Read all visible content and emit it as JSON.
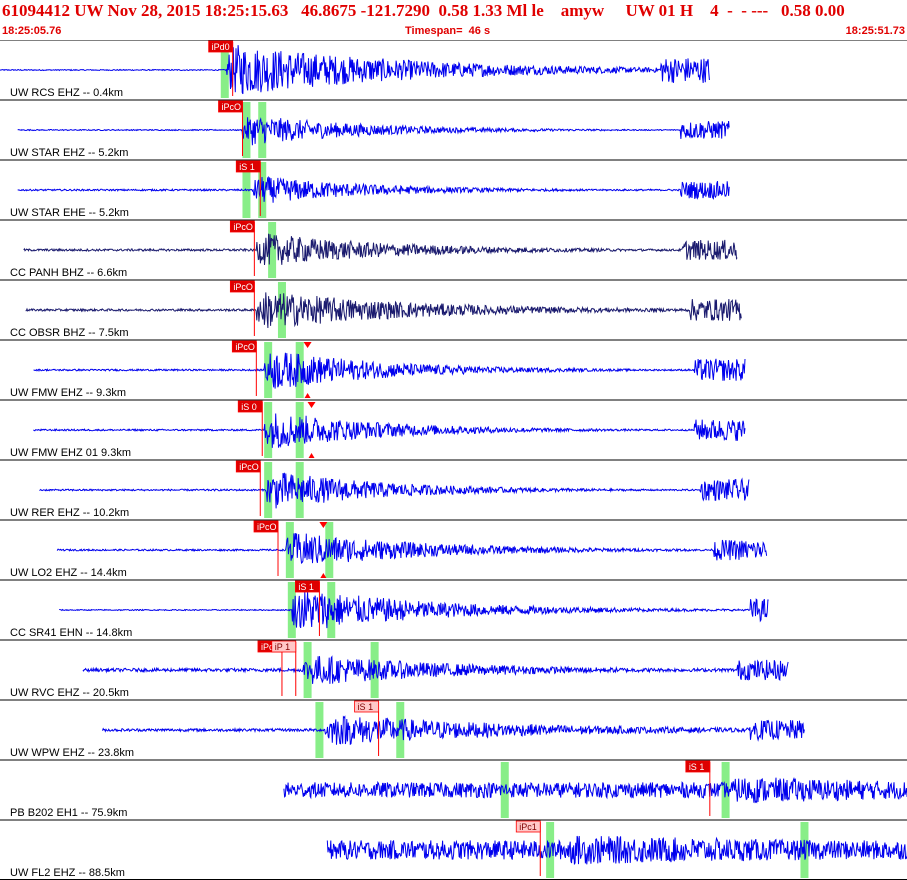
{
  "header": {
    "title": "61094412 UW Nov 28, 2015 18:25:15.63   46.8675 -121.7290  0.58 1.33 Ml le    amyw     UW 01 H    4  -  - ---   0.58 0.00",
    "start_time": "18:25:05.76",
    "timespan": "Timespan=  46 s",
    "end_time": "18:25:51.73"
  },
  "colors": {
    "header_text": "#e00000",
    "trace_blue": "#0000ee",
    "trace_navy": "#1a1a6e",
    "pick_marker": "#ff0000",
    "pick_window": "#88ee88",
    "pick_label_bg": "#dd0000",
    "pick_label_light_bg": "#ffc8c8",
    "panel_border": "#000000"
  },
  "chart_data": {
    "type": "line",
    "x_unit": "s",
    "xlim": [
      0,
      46
    ],
    "channels": [
      {
        "label": "UW RCS EHZ -- 0.4km",
        "color": "blue",
        "start": 0,
        "end": 36,
        "onset": 11.5,
        "amp": 1.0,
        "noise": 0.02,
        "decay": 9,
        "picks": [
          {
            "label": "iPd0",
            "t": 11.8,
            "style": "dark"
          }
        ],
        "windows": [
          11.4
        ],
        "burst": [
          33.5,
          36
        ]
      },
      {
        "label": "UW STAR EHZ -- 5.2km",
        "color": "blue",
        "start": 0.9,
        "end": 37,
        "onset": 12.3,
        "amp": 0.6,
        "noise": 0.02,
        "decay": 6,
        "picks": [
          {
            "label": "iPcO",
            "t": 12.3,
            "style": "dark"
          }
        ],
        "windows": [
          12.5,
          13.3
        ],
        "burst": [
          34.5,
          37
        ]
      },
      {
        "label": "UW STAR EHE -- 5.2km",
        "color": "blue",
        "start": 0.9,
        "end": 37,
        "onset": 12.8,
        "amp": 0.55,
        "noise": 0.03,
        "decay": 6,
        "picks": [
          {
            "label": "iS 1",
            "t": 13.2,
            "style": "dark"
          }
        ],
        "windows": [
          12.5,
          13.3
        ],
        "burst": [
          34.5,
          37
        ]
      },
      {
        "label": "CC PANH BHZ -- 6.6km",
        "color": "navy",
        "start": 1.2,
        "end": 37.4,
        "onset": 13.0,
        "amp": 0.65,
        "noise": 0.04,
        "decay": 7,
        "picks": [
          {
            "label": "iPcO",
            "t": 12.9,
            "style": "dark"
          }
        ],
        "windows": [
          13.8
        ],
        "burst": [
          34.6,
          37.4
        ]
      },
      {
        "label": "CC OBSR BHZ -- 7.5km",
        "color": "navy",
        "start": 1.3,
        "end": 37.6,
        "onset": 13.0,
        "amp": 0.75,
        "noise": 0.04,
        "decay": 8,
        "picks": [
          {
            "label": "iPcO",
            "t": 12.9,
            "style": "dark"
          }
        ],
        "windows": [
          14.3
        ],
        "burst": [
          35,
          37.6
        ]
      },
      {
        "label": "UW FMW EHZ -- 9.3km",
        "color": "blue",
        "start": 1.7,
        "end": 37.8,
        "onset": 13.4,
        "amp": 0.8,
        "noise": 0.03,
        "decay": 6,
        "picks": [
          {
            "label": "iPcO",
            "t": 13.0,
            "style": "dark"
          },
          {
            "label": "",
            "t": 15.6,
            "style": "triangle"
          }
        ],
        "windows": [
          13.6,
          15.2
        ],
        "burst": [
          35.2,
          37.8
        ]
      },
      {
        "label": "UW FMW EHZ 01 9.3km",
        "color": "blue",
        "start": 1.7,
        "end": 37.8,
        "onset": 13.4,
        "amp": 0.75,
        "noise": 0.03,
        "decay": 6,
        "picks": [
          {
            "label": "iS 0",
            "t": 13.3,
            "style": "dark"
          },
          {
            "label": "",
            "t": 15.8,
            "style": "triangle"
          }
        ],
        "windows": [
          13.6,
          15.2
        ],
        "burst": [
          35.2,
          37.8
        ]
      },
      {
        "label": "UW RER EHZ -- 10.2km",
        "color": "blue",
        "start": 2.0,
        "end": 38,
        "onset": 13.5,
        "amp": 0.75,
        "noise": 0.03,
        "decay": 6,
        "picks": [
          {
            "label": "iPcO",
            "t": 13.2,
            "style": "dark"
          }
        ],
        "windows": [
          13.6,
          15.2
        ],
        "burst": [
          35.5,
          38
        ]
      },
      {
        "label": "UW LO2 EHZ -- 14.4km",
        "color": "blue",
        "start": 2.9,
        "end": 38.9,
        "onset": 14.5,
        "amp": 0.7,
        "noise": 0.03,
        "decay": 7,
        "picks": [
          {
            "label": "iPcO",
            "t": 14.1,
            "style": "dark"
          },
          {
            "label": "",
            "t": 16.4,
            "style": "triangle"
          }
        ],
        "windows": [
          14.7,
          16.7
        ],
        "burst": [
          36.2,
          38.9
        ]
      },
      {
        "label": "CC SR41 EHN -- 14.8km",
        "color": "blue",
        "start": 3.0,
        "end": 39,
        "onset": 14.8,
        "amp": 0.85,
        "noise": 0.02,
        "decay": 7,
        "picks": [
          {
            "label": "iS 1",
            "t": 16.2,
            "style": "dark"
          }
        ],
        "windows": [
          14.8,
          16.8
        ],
        "burst": [
          38,
          39
        ]
      },
      {
        "label": "UW RVC EHZ -- 20.5km",
        "color": "blue",
        "start": 4.2,
        "end": 40,
        "onset": 15.4,
        "amp": 0.6,
        "noise": 0.06,
        "decay": 8,
        "picks": [
          {
            "label": "iPc1",
            "t": 14.3,
            "style": "dark"
          },
          {
            "label": "iP 1",
            "t": 15.0,
            "style": "light"
          }
        ],
        "windows": [
          15.6,
          19.0
        ],
        "burst": [
          37.4,
          40
        ]
      },
      {
        "label": "UW WPW EHZ -- 23.8km",
        "color": "blue",
        "start": 5.2,
        "end": 40.8,
        "onset": 16.5,
        "amp": 0.6,
        "noise": 0.05,
        "decay": 10,
        "picks": [
          {
            "label": "iS 1",
            "t": 19.2,
            "style": "light"
          }
        ],
        "windows": [
          16.2,
          20.3
        ],
        "burst": [
          38,
          40.8
        ]
      },
      {
        "label": "PB B202 EH1 -- 75.9km",
        "color": "blue",
        "start": 14.4,
        "end": 50,
        "onset": 37,
        "amp": 0.5,
        "noise": 0.28,
        "decay": 20,
        "picks": [
          {
            "label": "iS 1",
            "t": 36.0,
            "style": "dark"
          }
        ],
        "windows": [
          25.6,
          36.8
        ],
        "burst": [
          49,
          50
        ]
      },
      {
        "label": "UW FL2 EHZ -- 88.5km",
        "color": "blue",
        "start": 16.6,
        "end": 52,
        "onset": 28.5,
        "amp": 0.55,
        "noise": 0.35,
        "decay": 30,
        "picks": [
          {
            "label": "iPc1",
            "t": 27.4,
            "style": "light"
          }
        ],
        "windows": [
          27.9,
          40.8
        ],
        "burst": [
          51,
          52
        ]
      }
    ]
  }
}
